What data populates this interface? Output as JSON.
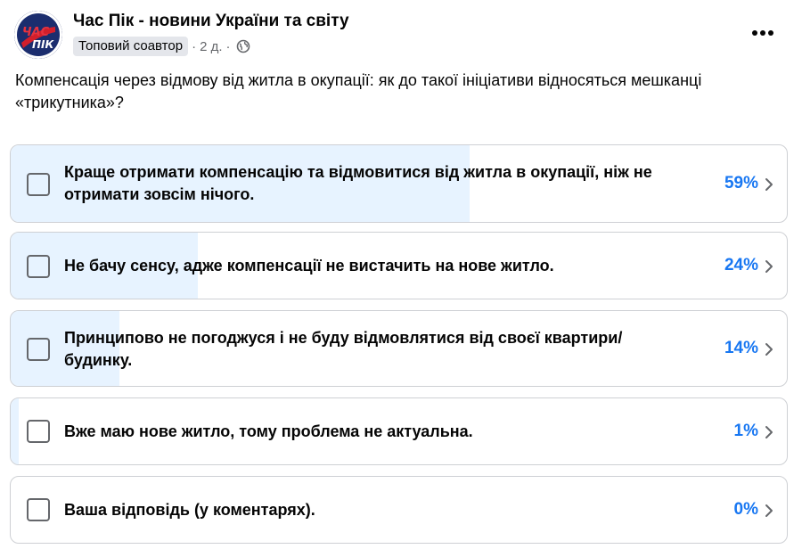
{
  "header": {
    "page_name": "Час Пік - новини України та світу",
    "avatar_text_1": "ЧАС",
    "avatar_text_2": "ПІК",
    "badge": "Топовий соавтор",
    "time": "2 д.",
    "separator": "·"
  },
  "post": {
    "question": "Компенсація через відмову від житла в окупації: як до такої ініціативи відносяться мешканці «трикутника»?"
  },
  "poll": {
    "options": [
      {
        "label": "Краще отримати компенсацію та відмовитися від житла в окупації, ніж не отримати зовсім нічого.",
        "percent_text": "59%",
        "fill_fraction": 0.59
      },
      {
        "label": "Не бачу сенсу, адже компенсації не вистачить на нове житло.",
        "percent_text": "24%",
        "fill_fraction": 0.24
      },
      {
        "label": "Принципово не погоджуся і не буду відмовлятися від своєї квартири/будинку.",
        "percent_text": "14%",
        "fill_fraction": 0.14
      },
      {
        "label": "Вже маю нове житло, тому проблема не актуальна.",
        "percent_text": "1%",
        "fill_fraction": 0.01
      },
      {
        "label": "Ваша відповідь (у коментарях).",
        "percent_text": "0%",
        "fill_fraction": 0.0
      }
    ]
  },
  "colors": {
    "accent": "#1877f2",
    "fill": "#e7f3ff",
    "border": "#ced0d4"
  },
  "icons": [
    "globe-icon",
    "more-icon",
    "chevron-right-icon",
    "checkbox"
  ]
}
